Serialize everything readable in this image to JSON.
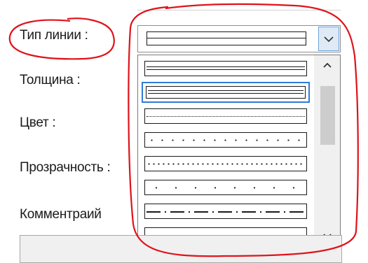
{
  "labels": {
    "line_type": "Тип линии :",
    "thickness": "Толщина :",
    "color": "Цвет :",
    "transparency": "Прозрачность :",
    "comment": "Комментраий"
  },
  "line_options": [
    {
      "style": "double"
    },
    {
      "style": "double-thin"
    },
    {
      "style": "fine-dotted"
    },
    {
      "style": "sparse-dotted"
    },
    {
      "style": "dotted"
    },
    {
      "style": "widely-dotted"
    },
    {
      "style": "long-dash-dot"
    },
    {
      "style": "dashed"
    }
  ],
  "selected_option_index": 1,
  "colors": {
    "annotation": "#e0121a",
    "selection": "#2f7cd6"
  },
  "icons": {
    "combo_arrow": "chevron-down-icon",
    "scroll_up": "chevron-up-icon",
    "scroll_down": "chevron-down-icon"
  }
}
